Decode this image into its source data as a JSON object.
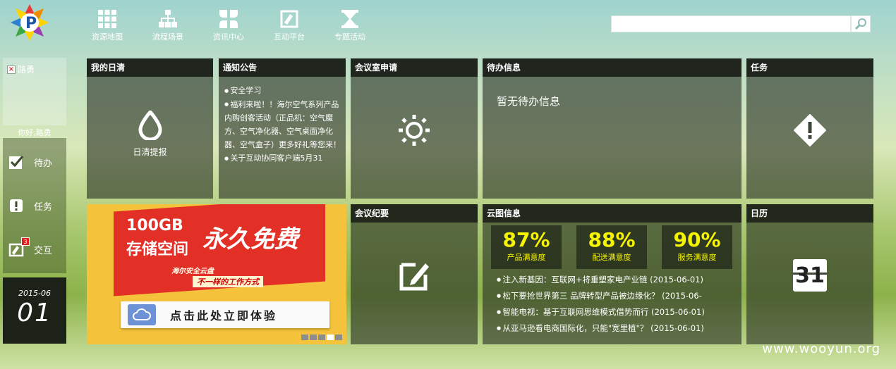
{
  "nav": {
    "items": [
      {
        "label": "资源地图",
        "icon": "grid-icon"
      },
      {
        "label": "流程场景",
        "icon": "org-chart-icon"
      },
      {
        "label": "资讯中心",
        "icon": "clover-icon"
      },
      {
        "label": "互动平台",
        "icon": "edit-board-icon"
      },
      {
        "label": "专题活动",
        "icon": "hourglass-icon"
      }
    ]
  },
  "search": {
    "value": "",
    "icon": "search-icon"
  },
  "user": {
    "photo_alt": "路勇",
    "greeting": "你好,路勇"
  },
  "sidebar": {
    "items": [
      {
        "label": "待办",
        "icon": "check-icon"
      },
      {
        "label": "任务",
        "icon": "exclamation-icon"
      },
      {
        "label": "交互",
        "icon": "interact-icon",
        "badge": "3"
      }
    ],
    "date": {
      "year_month": "2015-06",
      "day": "01"
    }
  },
  "tiles": {
    "rizhi": {
      "title": "我的日清",
      "action": "日清提报"
    },
    "notice": {
      "title": "通知公告",
      "items": [
        "安全学习",
        "福利来啦！！海尔空气系列产品内购创客活动（正品机：空气魔方、空气净化器、空气桌面净化器、空气盒子）更多好礼等您来！",
        "关于互动协同客户端5月31"
      ]
    },
    "meeting_apply": {
      "title": "会议室申请"
    },
    "todo": {
      "title": "待办信息",
      "empty": "暂无待办信息"
    },
    "task": {
      "title": "任务"
    },
    "meeting_minutes": {
      "title": "会议纪要"
    },
    "cloud": {
      "title": "云图信息",
      "stats": [
        {
          "value": "87%",
          "label": "产品满意度"
        },
        {
          "value": "88%",
          "label": "配送满意度"
        },
        {
          "value": "90%",
          "label": "服务满意度"
        }
      ],
      "news": [
        "注入新基因：互联网+将重塑家电产业链 (2015-06-01)",
        "松下要抢世界第三 品牌转型产品被边缘化？ (2015-06-",
        "智能电视：基于互联网思维模式借势而行 (2015-06-01)",
        "从亚马逊看电商国际化，只能\"宽里植\"？ (2015-06-01)"
      ]
    },
    "calendar": {
      "title": "日历",
      "day": "31"
    }
  },
  "banner": {
    "line1": "100GB",
    "line2": "存储空间",
    "headline": "永久免费",
    "sub1": "海尔安全云盘",
    "sub2": "不一样的工作方式",
    "cta": "点击此处立即体验",
    "slides": 5,
    "active_slide": 4
  },
  "watermark": "www.wooyun.org",
  "colors": {
    "stat_yellow": "#f5f500",
    "tile_header": "#22281c",
    "banner_red": "#e33027"
  }
}
